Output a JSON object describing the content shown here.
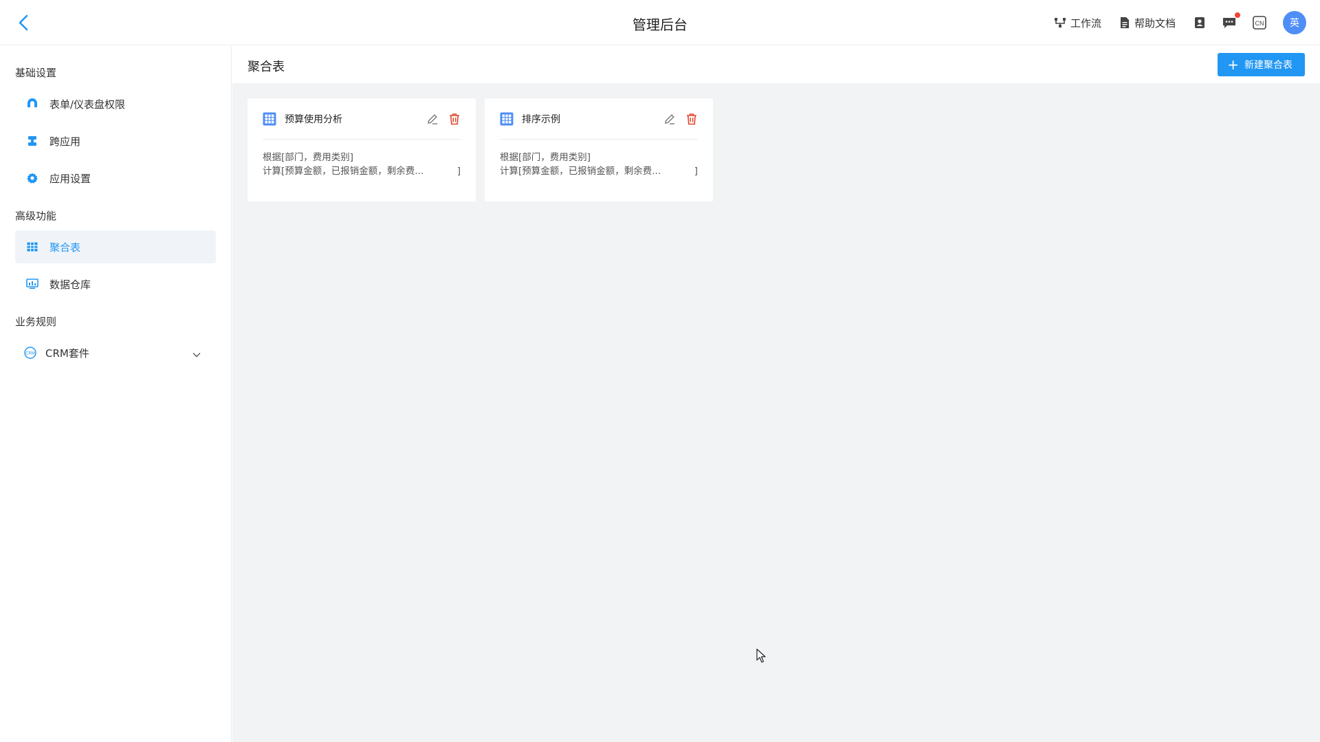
{
  "header": {
    "title": "管理后台",
    "workflow": "工作流",
    "help_docs": "帮助文档",
    "lang": "CN",
    "avatar_text": "英"
  },
  "sidebar": {
    "sections": [
      {
        "title": "基础设置",
        "items": [
          {
            "label": "表单/仪表盘权限",
            "icon": "permission-icon"
          },
          {
            "label": "跨应用",
            "icon": "cross-app-icon"
          },
          {
            "label": "应用设置",
            "icon": "gear-icon"
          }
        ]
      },
      {
        "title": "高级功能",
        "items": [
          {
            "label": "聚合表",
            "icon": "table-icon",
            "active": true
          },
          {
            "label": "数据仓库",
            "icon": "data-warehouse-icon"
          }
        ]
      },
      {
        "title": "业务规则",
        "items": [
          {
            "label": "CRM套件",
            "icon": "crm-icon",
            "expandable": true
          }
        ]
      }
    ]
  },
  "main": {
    "title": "聚合表",
    "new_button": "新建聚合表",
    "cards": [
      {
        "title": "预算使用分析",
        "line1": "根据[部门，费用类别]",
        "line2": "计算[预算金额，已报销金额，剩余费...",
        "line2_end": "]"
      },
      {
        "title": "排序示例",
        "line1": "根据[部门，费用类别]",
        "line2": "计算[预算金额，已报销金额，剩余费...",
        "line2_end": "]"
      }
    ]
  },
  "colors": {
    "accent": "#2196f3",
    "delete": "#e0452e",
    "avatar": "#4f8ef7",
    "content_bg": "#f2f3f5"
  }
}
